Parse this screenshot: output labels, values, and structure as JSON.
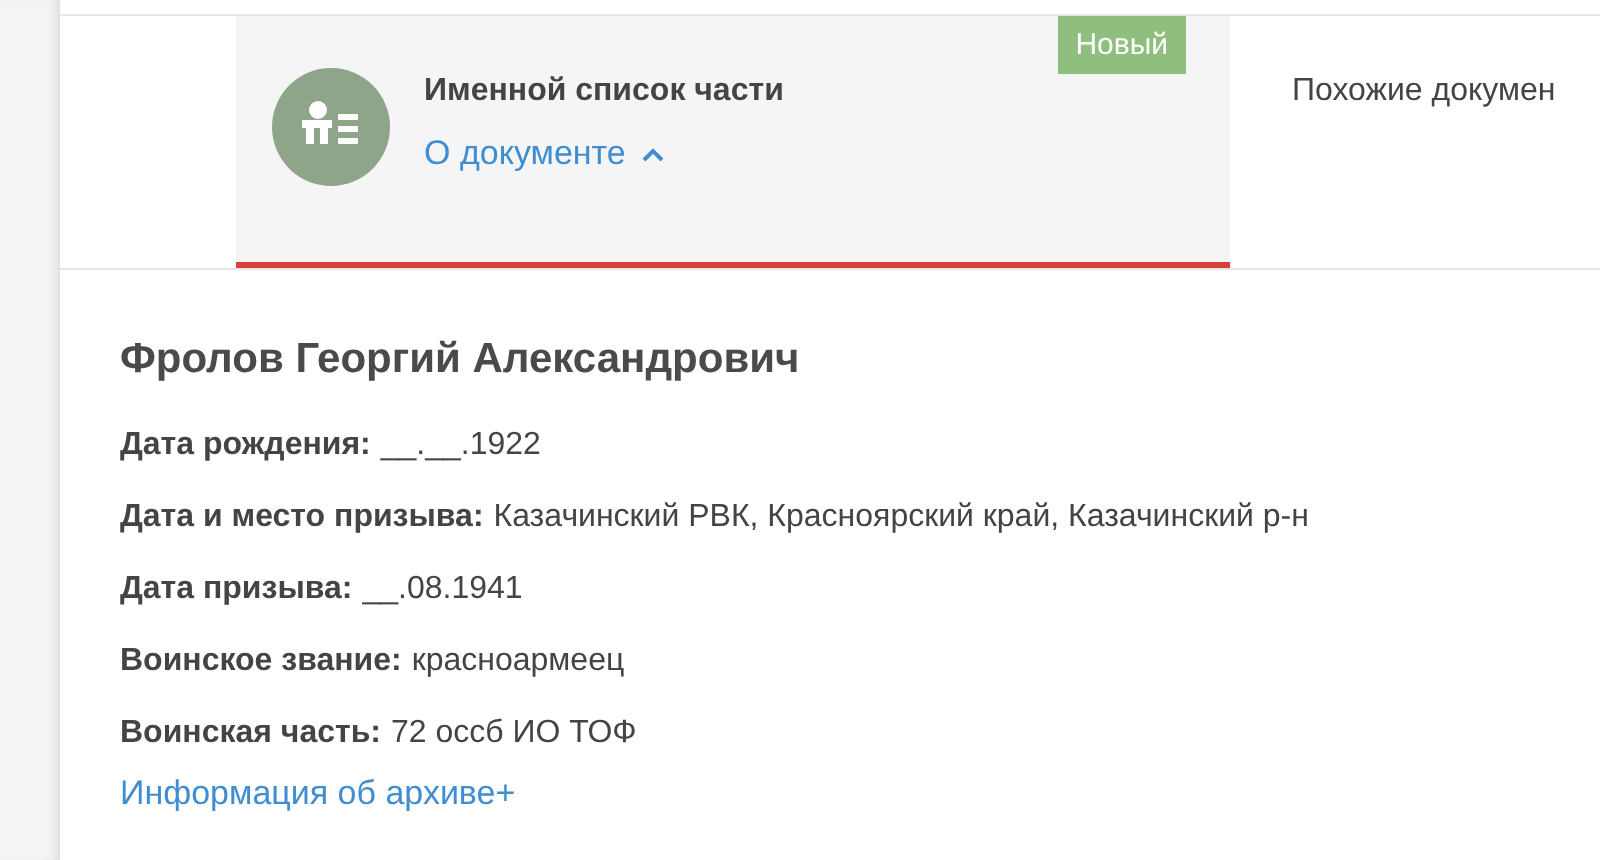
{
  "tabs": [
    {
      "title": "Именной список части",
      "badge": "Новый",
      "link": {
        "label": "О документе",
        "expanded": true
      },
      "selected": true
    },
    {
      "title": "Похожие докумен",
      "selected": false
    }
  ],
  "record": {
    "name": "Фролов Георгий Александрович",
    "fields": [
      {
        "label": "Дата рождения:",
        "value": "__.__.1922"
      },
      {
        "label": "Дата и место призыва:",
        "value": "Казачинский РВК, Красноярский край, Казачинский р-н"
      },
      {
        "label": "Дата призыва:",
        "value": "__.08.1941"
      },
      {
        "label": "Воинское звание:",
        "value": "красноармеец"
      },
      {
        "label": "Воинская часть:",
        "value": "72 оссб ИО ТОФ"
      }
    ],
    "archive_link": "Информация об архиве+"
  }
}
